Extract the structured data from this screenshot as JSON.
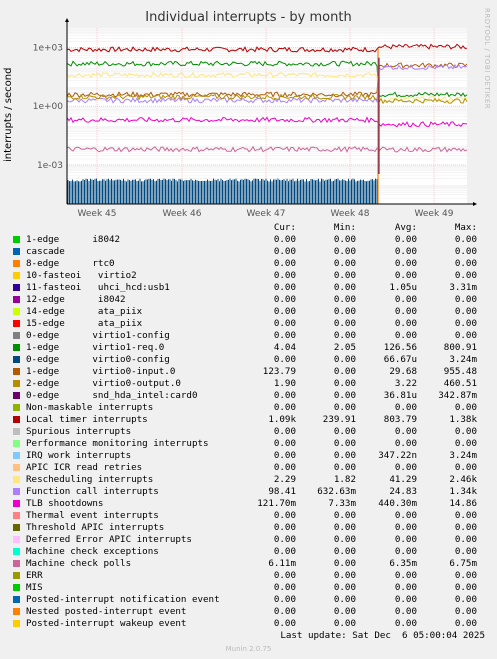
{
  "title": "Individual interrupts - by month",
  "side_text": "RRDTOOL / TOBI OETIKER",
  "footer": {
    "last_update": "Last update: Sat Dec  6 05:00:04 2025",
    "munin": "Munin 2.0.75"
  },
  "legend_headers": [
    "Cur:",
    "Min:",
    "Avg:",
    "Max:"
  ],
  "legend": [
    {
      "label": "1-edge      i8042",
      "color": "#00cc00",
      "cur": "0.00",
      "min": "0.00",
      "avg": "0.00",
      "max": "0.00"
    },
    {
      "label": "cascade",
      "color": "#0066b3",
      "cur": "0.00",
      "min": "0.00",
      "avg": "0.00",
      "max": "0.00"
    },
    {
      "label": "8-edge      rtc0",
      "color": "#ff8000",
      "cur": "0.00",
      "min": "0.00",
      "avg": "0.00",
      "max": "0.00"
    },
    {
      "label": "10-fasteoi   virtio2",
      "color": "#ffcc00",
      "cur": "0.00",
      "min": "0.00",
      "avg": "0.00",
      "max": "0.00"
    },
    {
      "label": "11-fasteoi   uhci_hcd:usb1",
      "color": "#330099",
      "cur": "0.00",
      "min": "0.00",
      "avg": "1.05u",
      "max": "3.31m"
    },
    {
      "label": "12-edge      i8042",
      "color": "#990099",
      "cur": "0.00",
      "min": "0.00",
      "avg": "0.00",
      "max": "0.00"
    },
    {
      "label": "14-edge      ata_piix",
      "color": "#ccff00",
      "cur": "0.00",
      "min": "0.00",
      "avg": "0.00",
      "max": "0.00"
    },
    {
      "label": "15-edge      ata_piix",
      "color": "#ff0000",
      "cur": "0.00",
      "min": "0.00",
      "avg": "0.00",
      "max": "0.00"
    },
    {
      "label": "0-edge      virtio1-config",
      "color": "#808080",
      "cur": "0.00",
      "min": "0.00",
      "avg": "0.00",
      "max": "0.00"
    },
    {
      "label": "1-edge      virtio1-req.0",
      "color": "#008f00",
      "cur": "4.04",
      "min": "2.05",
      "avg": "126.56",
      "max": "800.91"
    },
    {
      "label": "0-edge      virtio0-config",
      "color": "#00487d",
      "cur": "0.00",
      "min": "0.00",
      "avg": "66.67u",
      "max": "3.24m"
    },
    {
      "label": "1-edge      virtio0-input.0",
      "color": "#b35a00",
      "cur": "123.79",
      "min": "0.00",
      "avg": "29.68",
      "max": "955.48"
    },
    {
      "label": "2-edge      virtio0-output.0",
      "color": "#b38f00",
      "cur": "1.90",
      "min": "0.00",
      "avg": "3.22",
      "max": "460.51"
    },
    {
      "label": "0-edge      snd_hda_intel:card0",
      "color": "#6b006b",
      "cur": "0.00",
      "min": "0.00",
      "avg": "36.81u",
      "max": "342.87m"
    },
    {
      "label": "Non-maskable interrupts",
      "color": "#8fb300",
      "cur": "0.00",
      "min": "0.00",
      "avg": "0.00",
      "max": "0.00"
    },
    {
      "label": "Local timer interrupts",
      "color": "#b30000",
      "cur": "1.09k",
      "min": "239.91",
      "avg": "803.79",
      "max": "1.38k"
    },
    {
      "label": "Spurious interrupts",
      "color": "#bebebe",
      "cur": "0.00",
      "min": "0.00",
      "avg": "0.00",
      "max": "0.00"
    },
    {
      "label": "Performance monitoring interrupts",
      "color": "#80ff80",
      "cur": "0.00",
      "min": "0.00",
      "avg": "0.00",
      "max": "0.00"
    },
    {
      "label": "IRQ work interrupts",
      "color": "#80c9ff",
      "cur": "0.00",
      "min": "0.00",
      "avg": "347.22n",
      "max": "3.24m"
    },
    {
      "label": "APIC ICR read retries",
      "color": "#ffc080",
      "cur": "0.00",
      "min": "0.00",
      "avg": "0.00",
      "max": "0.00"
    },
    {
      "label": "Rescheduling interrupts",
      "color": "#ffe680",
      "cur": "2.29",
      "min": "1.82",
      "avg": "41.29",
      "max": "2.46k"
    },
    {
      "label": "Function call interrupts",
      "color": "#aa80ff",
      "cur": "98.41",
      "min": "632.63m",
      "avg": "24.83",
      "max": "1.34k"
    },
    {
      "label": "TLB shootdowns",
      "color": "#ee00cc",
      "cur": "121.70m",
      "min": "7.33m",
      "avg": "440.30m",
      "max": "14.86"
    },
    {
      "label": "Thermal event interrupts",
      "color": "#ff8080",
      "cur": "0.00",
      "min": "0.00",
      "avg": "0.00",
      "max": "0.00"
    },
    {
      "label": "Threshold APIC interrupts",
      "color": "#666600",
      "cur": "0.00",
      "min": "0.00",
      "avg": "0.00",
      "max": "0.00"
    },
    {
      "label": "Deferred Error APIC interrupts",
      "color": "#ffbfff",
      "cur": "0.00",
      "min": "0.00",
      "avg": "0.00",
      "max": "0.00"
    },
    {
      "label": "Machine check exceptions",
      "color": "#00ffcc",
      "cur": "0.00",
      "min": "0.00",
      "avg": "0.00",
      "max": "0.00"
    },
    {
      "label": "Machine check polls",
      "color": "#cc6699",
      "cur": "6.11m",
      "min": "0.00",
      "avg": "6.35m",
      "max": "6.75m"
    },
    {
      "label": "ERR",
      "color": "#999900",
      "cur": "0.00",
      "min": "0.00",
      "avg": "0.00",
      "max": "0.00"
    },
    {
      "label": "MIS",
      "color": "#00cc00",
      "cur": "0.00",
      "min": "0.00",
      "avg": "0.00",
      "max": "0.00"
    },
    {
      "label": "Posted-interrupt notification event",
      "color": "#0066b3",
      "cur": "0.00",
      "min": "0.00",
      "avg": "0.00",
      "max": "0.00"
    },
    {
      "label": "Nested posted-interrupt event",
      "color": "#ff8000",
      "cur": "0.00",
      "min": "0.00",
      "avg": "0.00",
      "max": "0.00"
    },
    {
      "label": "Posted-interrupt wakeup event",
      "color": "#ffcc00",
      "cur": "0.00",
      "min": "0.00",
      "avg": "0.00",
      "max": "0.00"
    }
  ],
  "chart_data": {
    "type": "line",
    "title": "Individual interrupts - by month",
    "ylabel": "interrupts / second",
    "yscale": "log",
    "ylim": [
      1e-05,
      10000
    ],
    "ytick_values": [
      1000,
      1,
      0.001
    ],
    "ytick_labels": [
      "1e+03",
      "1e+00",
      "1e-03"
    ],
    "x_categories": [
      "Week 45",
      "Week 46",
      "Week 47",
      "Week 48",
      "Week 49"
    ],
    "grid": true,
    "series": [
      {
        "name": "Local timer interrupts",
        "color": "#b30000",
        "values_before": 800,
        "values_after": 1100
      },
      {
        "name": "1-edge      virtio1-req.0",
        "color": "#008f00",
        "values_before": 150,
        "values_after": 4
      },
      {
        "name": "Rescheduling interrupts",
        "color": "#ffe680",
        "values_before": 40,
        "values_after": 2.3
      },
      {
        "name": "1-edge      virtio0-input.0",
        "color": "#b35a00",
        "values_before": 4,
        "values_after": 124
      },
      {
        "name": "Function call interrupts",
        "color": "#aa80ff",
        "values_before": 2,
        "values_after": 98
      },
      {
        "name": "2-edge      virtio0-output.0",
        "color": "#b38f00",
        "values_before": 3,
        "values_after": 1.9
      },
      {
        "name": "TLB shootdowns",
        "color": "#ee00cc",
        "values_before": 0.2,
        "values_after": 0.12
      },
      {
        "name": "Machine check polls",
        "color": "#cc6699",
        "values_before": 0.0063,
        "values_after": 0.0061
      },
      {
        "name": "0-edge      virtio0-config",
        "color": "#00487d",
        "values_before": 0.0002,
        "values_after": 0
      }
    ]
  }
}
